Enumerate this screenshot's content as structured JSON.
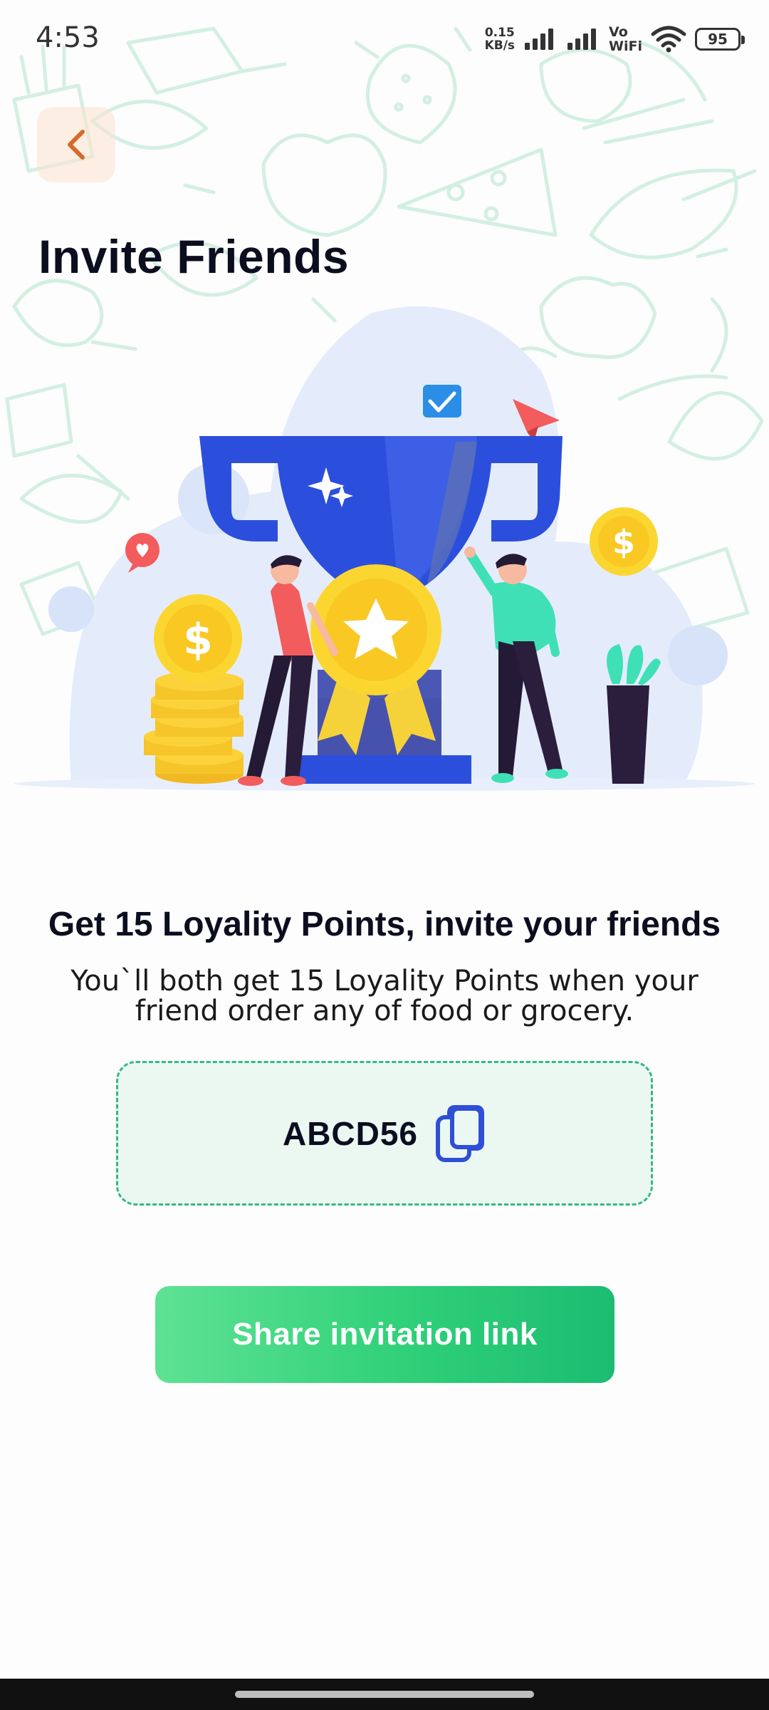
{
  "status_bar": {
    "time": "4:53",
    "net_speed_value": "0.15",
    "net_speed_unit": "KB/s",
    "vowifi_top": "Vo",
    "vowifi_bottom": "WiFi",
    "battery_level": "95",
    "icons": [
      "signal-icon",
      "signal-icon",
      "wifi-icon",
      "battery-icon"
    ]
  },
  "header": {
    "back_icon": "chevron-left-icon",
    "title": "Invite Friends"
  },
  "invite": {
    "headline": "Get 15 Loyality Points, invite your friends",
    "description": "You`ll both get 15 Loyality Points when your friend order any of food or grocery.",
    "referral_code": "ABCD56",
    "copy_icon": "copy-icon",
    "share_button_label": "Share invitation link"
  },
  "colors": {
    "accent_green": "#2fd078",
    "code_border": "#33b984",
    "code_bg": "#ebf8f2",
    "back_button_bg": "#fde1cd",
    "back_chevron": "#d66a2c",
    "copy_icon_blue": "#2f4fd6",
    "trophy_blue": "#2b4fdc",
    "doodle_green": "#cfeee0"
  }
}
